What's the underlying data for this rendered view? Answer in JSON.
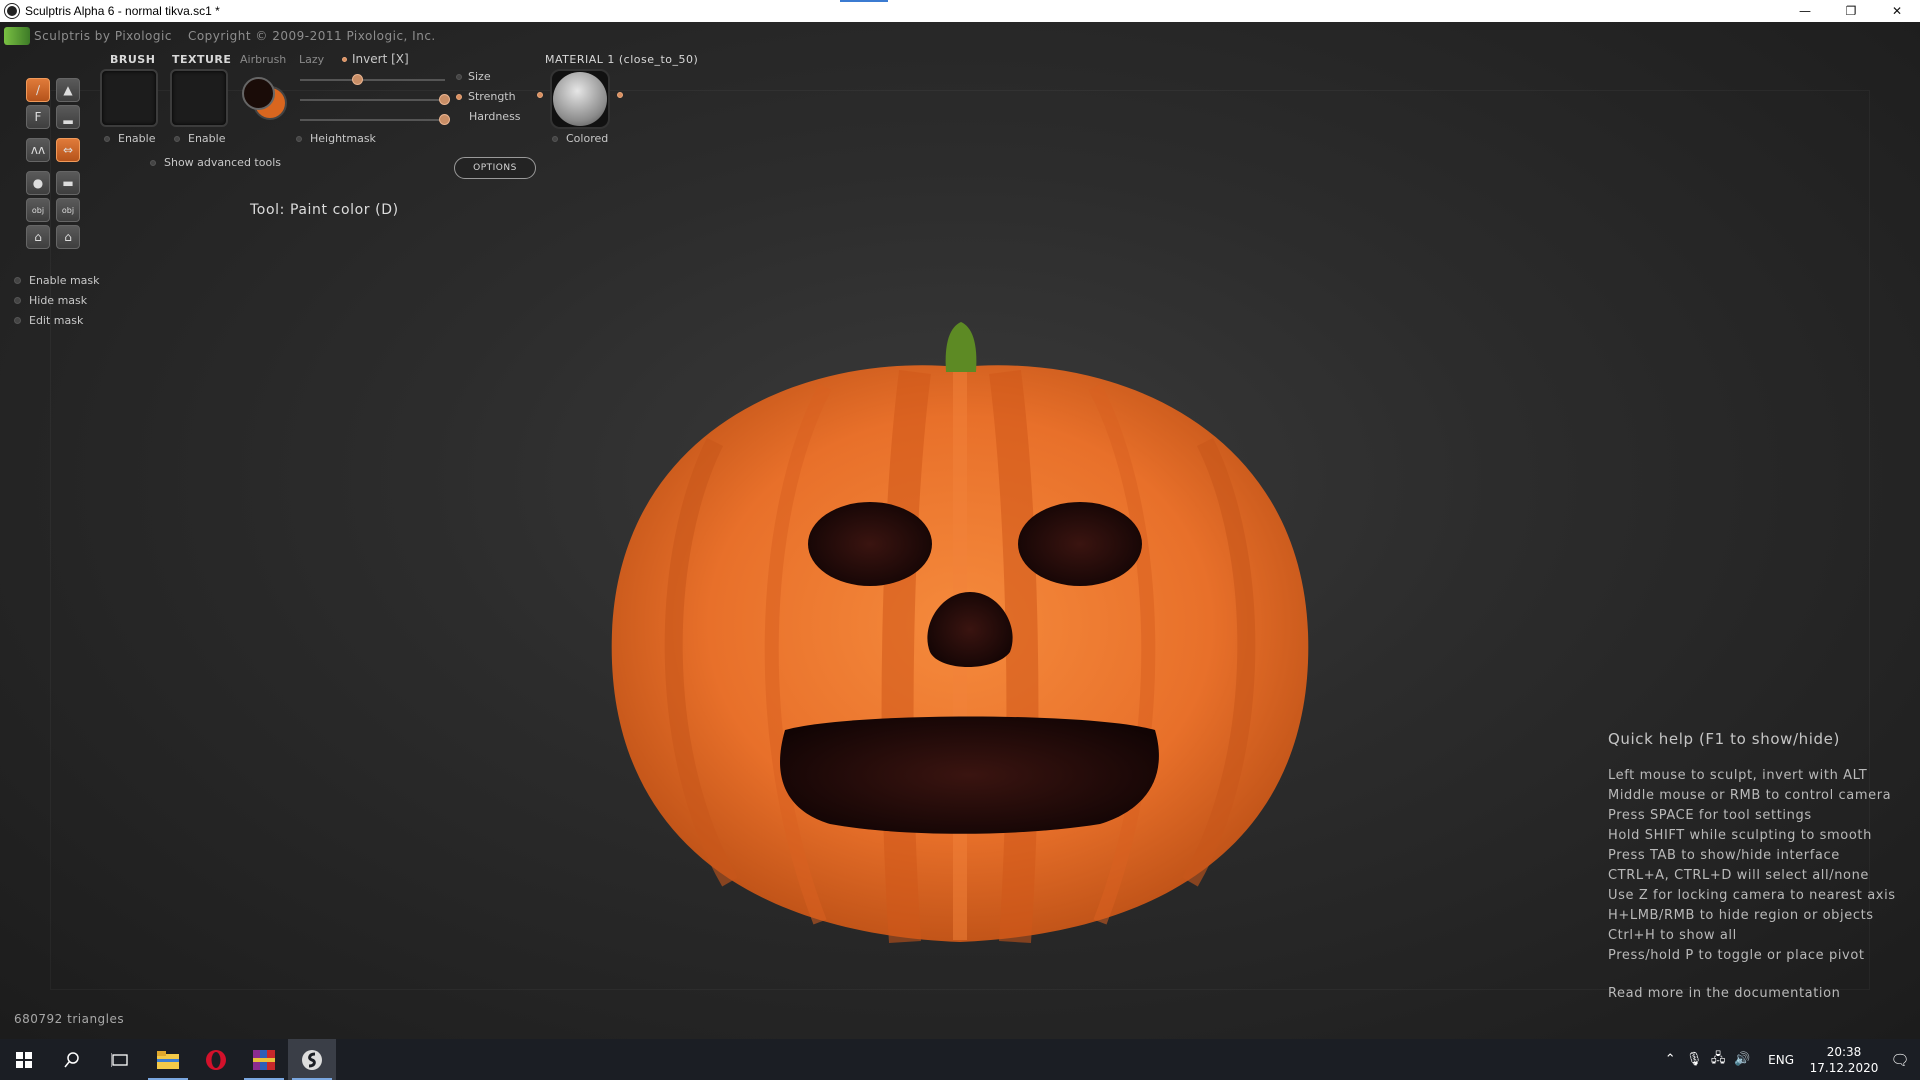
{
  "window": {
    "title": "Sculptris Alpha 6 - normal tikva.sc1 *",
    "minimize": "—",
    "maximize": "❐",
    "close": "✕"
  },
  "app": {
    "name": "Sculptris by Pixologic",
    "copyright": "Copyright © 2009-2011 Pixologic, Inc."
  },
  "panel": {
    "brush_label": "BRUSH",
    "texture_label": "TEXTURE",
    "airbrush_label": "Airbrush",
    "lazy_label": "Lazy",
    "invert_label": "Invert [X]",
    "size_label": "Size",
    "strength_label": "Strength",
    "hardness_label": "Hardness",
    "heightmask_label": "Heightmask",
    "options_label": "OPTIONS",
    "material_label": "MATERIAL 1 (close_to_50)",
    "colored_label": "Colored",
    "brush_enable_label": "Enable",
    "texture_enable_label": "Enable",
    "show_advanced_label": "Show advanced tools",
    "primary_color": "#1a0c08",
    "secondary_color": "#d9661f"
  },
  "sliders": {
    "size": 0.4,
    "strength": 1.0,
    "hardness": 1.0
  },
  "tool_name": "Tool: Paint color (D)",
  "mask": {
    "enable": "Enable mask",
    "hide": "Hide mask",
    "edit": "Edit mask"
  },
  "tools": [
    {
      "name": "draw-tool-icon",
      "glyph": "∕",
      "active": true
    },
    {
      "name": "inflate-tool-icon",
      "glyph": "▲",
      "active": false
    },
    {
      "name": "flatten-tool-icon",
      "glyph": "F",
      "active": false
    },
    {
      "name": "crease-tool-icon",
      "glyph": "▂",
      "active": false
    },
    {
      "name": "pinch-tool-icon",
      "glyph": "ʌʌ",
      "active": false
    },
    {
      "name": "symmetry-tool-icon",
      "glyph": "⇔",
      "active": true
    },
    {
      "name": "sphere-tool-icon",
      "glyph": "●",
      "active": false
    },
    {
      "name": "plane-tool-icon",
      "glyph": "▬",
      "active": false
    },
    {
      "name": "import-obj-icon",
      "glyph": "obj",
      "active": false
    },
    {
      "name": "export-obj-icon",
      "glyph": "obj",
      "active": false
    },
    {
      "name": "open-file-icon",
      "glyph": "⌂",
      "active": false
    },
    {
      "name": "save-file-icon",
      "glyph": "⌂",
      "active": false
    }
  ],
  "quick_help": {
    "title": "Quick help (F1 to show/hide)",
    "lines": [
      "Left mouse to sculpt, invert with ALT",
      "Middle mouse or RMB to control camera",
      "Press SPACE for tool settings",
      "Hold SHIFT while sculpting to smooth",
      "Press TAB to show/hide interface",
      "CTRL+A, CTRL+D will select all/none",
      "Use Z for locking camera to nearest axis",
      "H+LMB/RMB to hide region or objects",
      "Ctrl+H to show all",
      "Press/hold P to toggle or place pivot"
    ],
    "footer": "Read more in the documentation"
  },
  "status": {
    "triangles": "680792 triangles"
  },
  "taskbar": {
    "lang": "ENG",
    "time": "20:38",
    "date": "17.12.2020"
  }
}
